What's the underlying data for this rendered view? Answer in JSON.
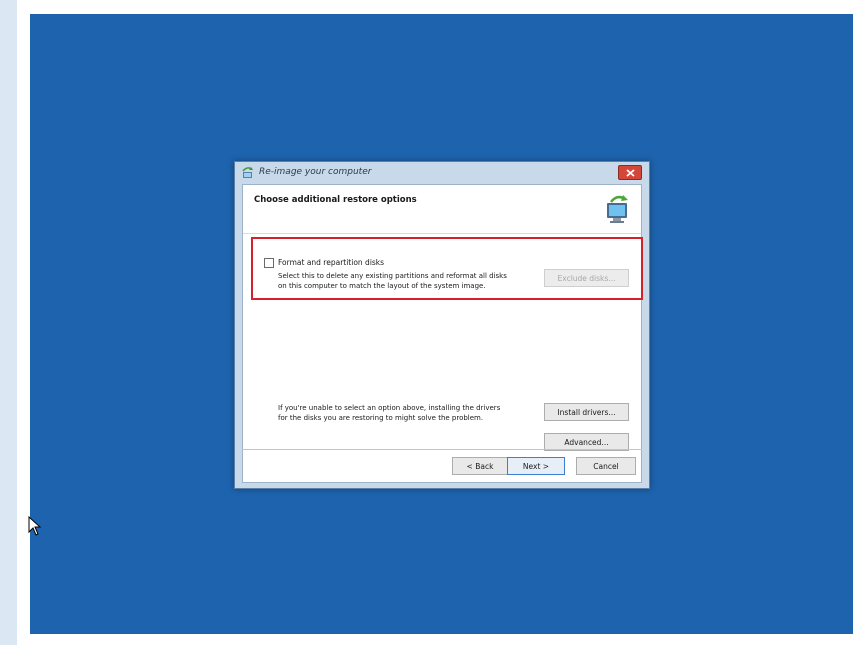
{
  "window": {
    "title": "Re-image your computer",
    "header": "Choose additional restore options"
  },
  "format_option": {
    "checkbox_label": "Format and repartition disks",
    "checked": false,
    "description_lines": [
      "Select this to delete any existing partitions and reformat all disks",
      "on this computer to match the layout of the system image."
    ],
    "exclude_button": "Exclude disks..."
  },
  "drivers": {
    "info_lines": [
      "If you're unable to select an option above, installing the drivers",
      "for the disks you are restoring to might solve the problem."
    ],
    "install_button": "Install drivers...",
    "advanced_button": "Advanced..."
  },
  "footer": {
    "back_button": "< Back",
    "next_button": "Next >",
    "cancel_button": "Cancel"
  },
  "icons": {
    "title": "restore-icon",
    "header": "computer-restore-icon",
    "close": "close-icon",
    "cursor": "mouse-pointer-icon"
  },
  "colors": {
    "desktop": "#1e63ae",
    "highlight": "#d3222b",
    "close_button": "#d2473a"
  }
}
